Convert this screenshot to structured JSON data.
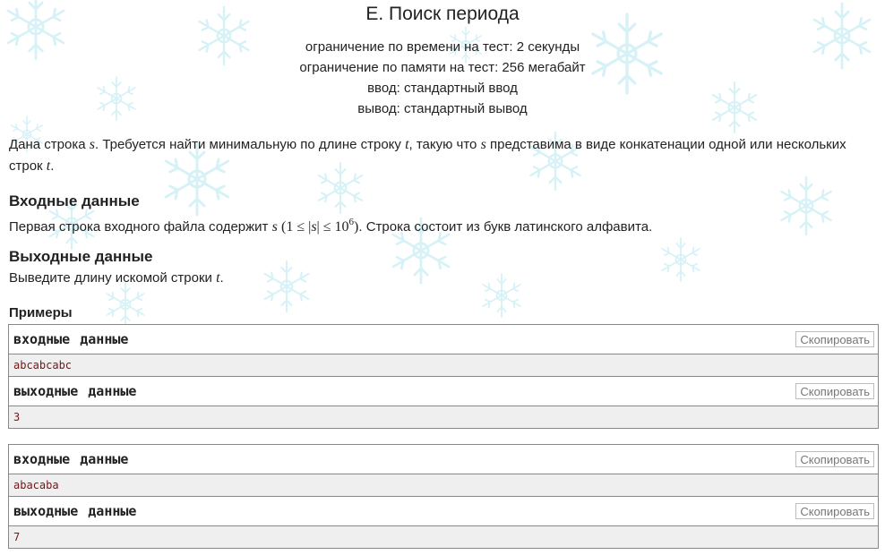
{
  "problem": {
    "title": "E. Поиск периода",
    "time_limit": "ограничение по времени на тест: 2 секунды",
    "memory_limit": "ограничение по памяти на тест: 256 мегабайт",
    "input": "ввод: стандартный ввод",
    "output": "вывод: стандартный вывод"
  },
  "statement": {
    "p1_a": "Дана строка ",
    "var_s": "s",
    "p1_b": ". Требуется найти минимальную по длине строку ",
    "var_t": "t",
    "p1_c": ", такую что ",
    "p1_d": " представима в виде конкатенации одной или нескольких строк ",
    "p1_e": "."
  },
  "input_section": {
    "title": "Входные данные",
    "text_a": "Первая строка входного файла содержит ",
    "math_open": "(1 ≤ |",
    "math_close": "| ≤ 10",
    "math_exp": "6",
    "math_end": ")",
    "text_b": ". Строка состоит из букв латинского алфавита."
  },
  "output_section": {
    "title": "Выходные данные",
    "text_a": "Выведите длину искомой строки ",
    "text_b": "."
  },
  "examples": {
    "title": "Примеры",
    "input_label": "входные данные",
    "output_label": "выходные данные",
    "copy_label": "Скопировать",
    "samples": [
      {
        "input": "abcabcabc",
        "output": "3"
      },
      {
        "input": "abacaba",
        "output": "7"
      }
    ]
  },
  "colors": {
    "snowflake": "#c9eef5",
    "sample_value": "#7a1414",
    "sample_bg": "#efefef"
  },
  "icons": {
    "background": "snowflake-pattern"
  }
}
